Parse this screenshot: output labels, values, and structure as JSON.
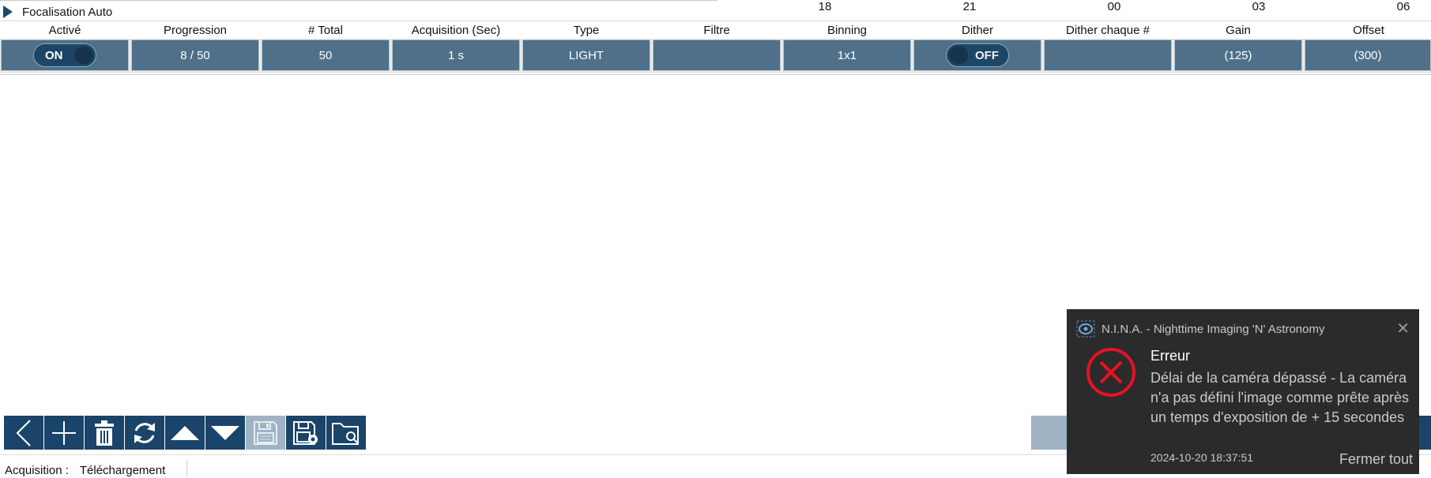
{
  "header": {
    "focus_label": "Focalisation Auto",
    "timeline_ticks": [
      "18",
      "21",
      "00",
      "03",
      "06"
    ]
  },
  "table": {
    "columns": [
      "Activé",
      "Progression",
      "# Total",
      "Acquisition (Sec)",
      "Type",
      "Filtre",
      "Binning",
      "Dither",
      "Dither chaque #",
      "Gain",
      "Offset"
    ],
    "row": {
      "enabled": "ON",
      "progress": "8 / 50",
      "total": "50",
      "exposure": "1 s",
      "type": "LIGHT",
      "filter": "",
      "binning": "1x1",
      "dither": "OFF",
      "dither_every": "",
      "gain": "(125)",
      "offset": "(300)"
    }
  },
  "toolbar": {
    "buttons": [
      "back-icon",
      "add-icon",
      "delete-icon",
      "reset-icon",
      "move-up-icon",
      "move-down-icon",
      "save-icon",
      "save-as-icon",
      "open-folder-icon"
    ]
  },
  "status": {
    "label": "Acquisition :",
    "value": "Téléchargement"
  },
  "toast": {
    "app_name": "N.I.N.A. - Nighttime Imaging 'N' Astronomy",
    "title": "Erreur",
    "message": "Délai de la caméra dépassé - La caméra n'a pas défini l'image comme prête après un temps d'exposition de + 15 secondes",
    "timestamp": "2024-10-20 18:37:51",
    "dismiss_all": "Fermer tout"
  },
  "colors": {
    "cell_bg": "#4f7088",
    "toolbar_bg": "#1a4469",
    "toast_bg": "#2b2b2b",
    "error_red": "#e81123"
  }
}
